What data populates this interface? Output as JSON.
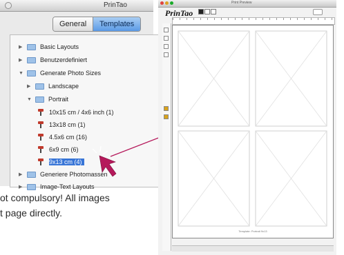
{
  "left_window": {
    "title": "PrinTao",
    "tabs": [
      {
        "label": "General",
        "selected": false
      },
      {
        "label": "Templates",
        "selected": true
      }
    ]
  },
  "tree": [
    {
      "label": "Basic Layouts",
      "kind": "folder",
      "expanded": false
    },
    {
      "label": "Benutzerdefiniert",
      "kind": "folder",
      "expanded": false
    },
    {
      "label": "Generate Photo Sizes",
      "kind": "folder",
      "expanded": true
    },
    {
      "label": "Landscape",
      "kind": "folder",
      "expanded": false
    },
    {
      "label": "Portrait",
      "kind": "folder",
      "expanded": true
    },
    {
      "label": "10x15 cm / 4x6 inch (1)",
      "kind": "template"
    },
    {
      "label": "13x18 cm (1)",
      "kind": "template"
    },
    {
      "label": "4.5x6 cm (16)",
      "kind": "template"
    },
    {
      "label": "6x9 cm (6)",
      "kind": "template"
    },
    {
      "label": "9x13 cm (4)",
      "kind": "template",
      "selected": true
    },
    {
      "label": "Generiere Photomassen",
      "kind": "folder",
      "expanded": false
    },
    {
      "label": "Image-Text Layouts",
      "kind": "folder",
      "expanded": false
    }
  ],
  "note": {
    "line1": "ot compulsory! All images",
    "line2": "t page directly."
  },
  "right_window": {
    "title": "Print Preview",
    "logo": "PrinTao",
    "page_caption": "Template: Portrait 9x13",
    "traffic_colors": [
      "#e0443e",
      "#dea123",
      "#1aab29"
    ]
  },
  "colors": {
    "accent_selection": "#3875d7",
    "arrow": "#b5195b"
  }
}
